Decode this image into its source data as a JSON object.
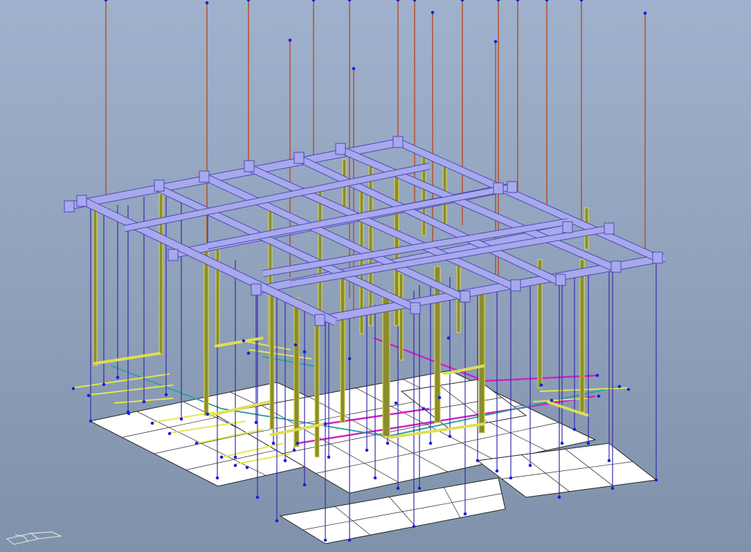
{
  "viewport": {
    "background_top": "#9fb1cc",
    "background_bottom": "#8092ab"
  },
  "colors": {
    "beam": "#a8a8ec",
    "beam_edge": "#4848b8",
    "column": "#8c8c2e",
    "column_edge": "#dede55",
    "hanger_rod": "#b84a1c",
    "drop_line": "#3a28a8",
    "node": "#1420e0",
    "slab": "#ffffff",
    "slab_edge": "#202020",
    "pipe_magenta": "#d020c8",
    "pipe_teal": "#30a0a0",
    "pipe_yellow": "#e6e650",
    "triad": "#e8f0e8"
  },
  "icons": {
    "view_triad": "axis-triad-icon"
  }
}
